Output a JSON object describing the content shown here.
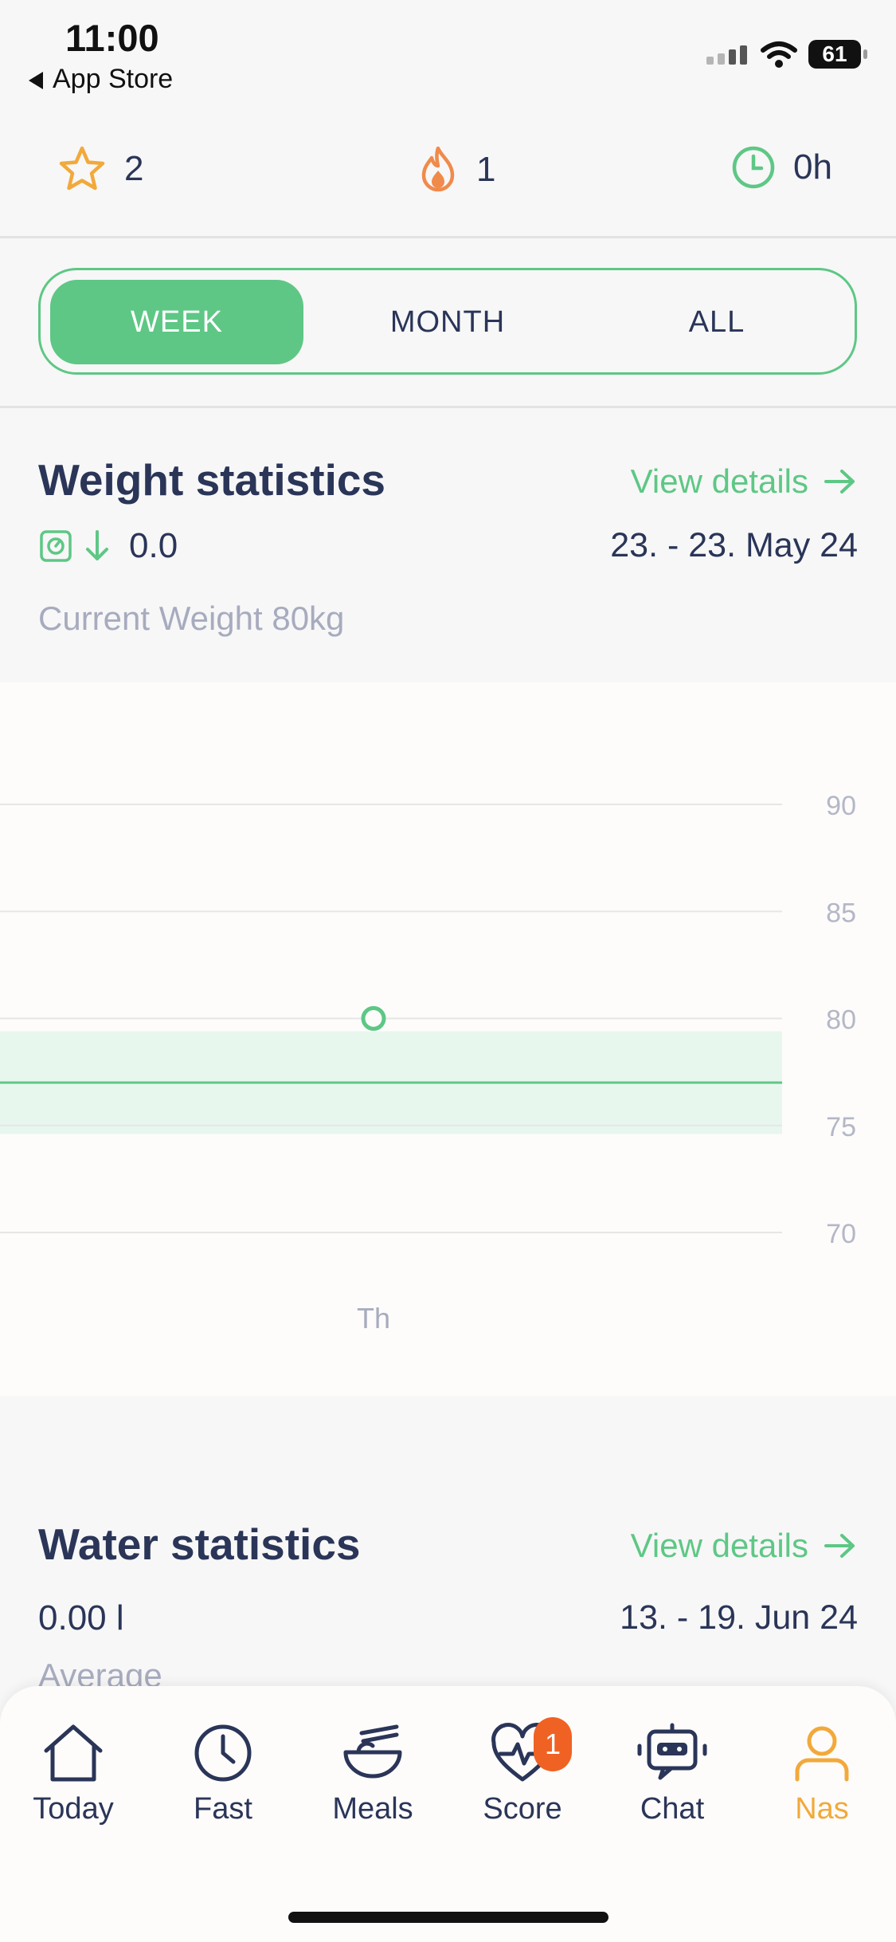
{
  "status_bar": {
    "time": "11:00",
    "back_label": "App Store",
    "battery": "61"
  },
  "top_stats": {
    "stars": "2",
    "streak": "1",
    "fast_hours": "0h"
  },
  "period_tabs": [
    {
      "label": "WEEK",
      "active": true
    },
    {
      "label": "MONTH",
      "active": false
    },
    {
      "label": "ALL",
      "active": false
    }
  ],
  "weight": {
    "title": "Weight statistics",
    "view_details": "View details",
    "change": "0.0",
    "date_range": "23. - 23. May 24",
    "current_weight": "Current Weight 80kg"
  },
  "chart_data": {
    "type": "scatter",
    "x_categories": [
      "Th"
    ],
    "points": [
      {
        "x": "Th",
        "y": 80
      }
    ],
    "y_ticks": [
      90,
      85,
      80,
      75,
      70
    ],
    "ylim": [
      70,
      90
    ],
    "target_line": 77,
    "target_band": [
      74.6,
      79.4
    ],
    "grid": true,
    "colors": {
      "point": "#5ec785",
      "band": "#e8f7ee",
      "line": "#5ec785"
    }
  },
  "water": {
    "title": "Water statistics",
    "view_details": "View details",
    "value": "0.00 l",
    "date_range": "13. - 19. Jun 24",
    "sub_label": "Average"
  },
  "tab_bar": {
    "items": [
      {
        "label": "Today",
        "icon": "home-icon"
      },
      {
        "label": "Fast",
        "icon": "clock-icon"
      },
      {
        "label": "Meals",
        "icon": "bowl-icon"
      },
      {
        "label": "Score",
        "icon": "heart-pulse-icon",
        "badge": "1"
      },
      {
        "label": "Chat",
        "icon": "robot-icon"
      },
      {
        "label": "Nas",
        "icon": "person-icon",
        "active": true
      }
    ]
  },
  "colors": {
    "accent": "#5ec785",
    "text": "#2a3558",
    "muted": "#a7abbe",
    "star": "#f2a93b",
    "flame": "#f08a4b",
    "badge": "#f06224"
  }
}
